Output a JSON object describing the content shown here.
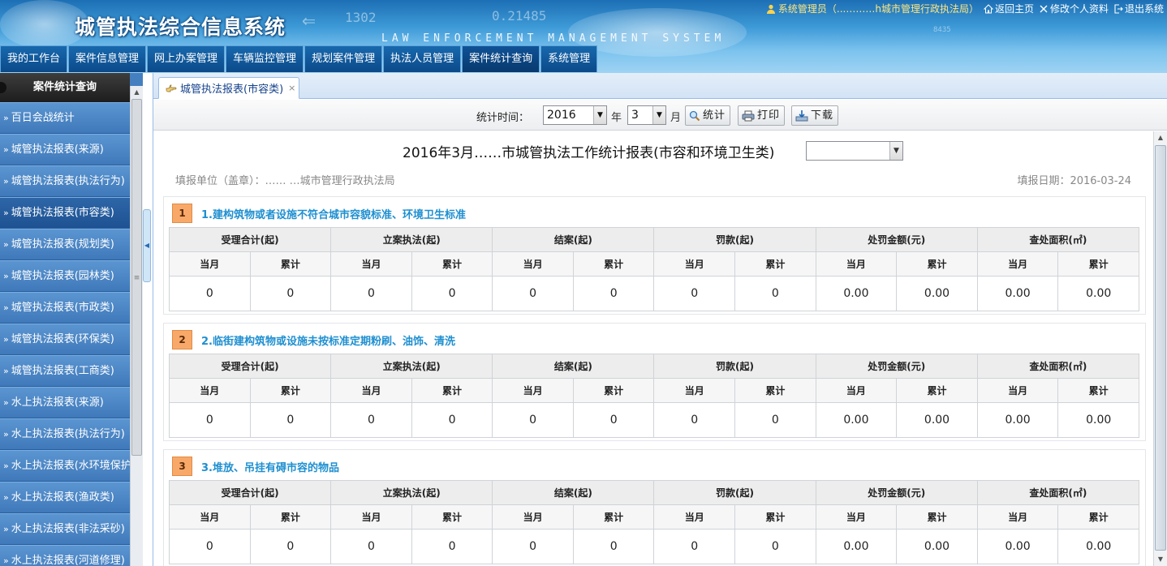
{
  "header": {
    "system_title": "城管执法综合信息系统",
    "subtitle": "LAW ENFORCEMENT MANAGEMENT SYSTEM",
    "deco_numbers": [
      "1302",
      "0.21485",
      "8435"
    ],
    "user_label": "系统管理员（...………h城市管理行政执法局）",
    "links": {
      "home": "返回主页",
      "profile": "修改个人资料",
      "logout": "退出系统"
    }
  },
  "main_nav": [
    "我的工作台",
    "案件信息管理",
    "网上办案管理",
    "车辆监控管理",
    "规划案件管理",
    "执法人员管理",
    "案件统计查询",
    "系统管理"
  ],
  "sidebar": {
    "title": "案件统计查询",
    "items": [
      "百日会战统计",
      "城管执法报表(来源)",
      "城管执法报表(执法行为)",
      "城管执法报表(市容类)",
      "城管执法报表(规划类)",
      "城管执法报表(园林类)",
      "城管执法报表(市政类)",
      "城管执法报表(环保类)",
      "城管执法报表(工商类)",
      "水上执法报表(来源)",
      "水上执法报表(执法行为)",
      "水上执法报表(水环境保护)",
      "水上执法报表(渔政类)",
      "水上执法报表(非法采砂)",
      "水上执法报表(河道修理)"
    ],
    "active_index": 3
  },
  "tab": {
    "label": "城管执法报表(市容类)"
  },
  "toolbar": {
    "label": "统计时间：",
    "year": "2016",
    "year_unit": "年",
    "month": "3",
    "month_unit": "月",
    "btn_stat": "统计",
    "btn_print": "打印",
    "btn_download": "下载"
  },
  "report": {
    "title": "2016年3月……市城管执法工作统计报表(市容和环境卫生类)",
    "fill_unit": "填报单位（盖章）：…… …城市管理行政执法局",
    "fill_date": "填报日期：2016-03-24",
    "col_groups": [
      "受理合计(起)",
      "立案执法(起)",
      "结案(起)",
      "罚款(起)",
      "处罚金额(元)",
      "查处面积(㎡)"
    ],
    "sub_cols": [
      "当月",
      "累计"
    ],
    "sections": [
      {
        "num": "1",
        "title": "1.建构筑物或者设施不符合城市容貌标准、环境卫生标准",
        "values": [
          "0",
          "0",
          "0",
          "0",
          "0",
          "0",
          "0",
          "0",
          "0.00",
          "0.00",
          "0.00",
          "0.00"
        ]
      },
      {
        "num": "2",
        "title": "2.临街建构筑物或设施未按标准定期粉刷、油饰、清洗",
        "values": [
          "0",
          "0",
          "0",
          "0",
          "0",
          "0",
          "0",
          "0",
          "0.00",
          "0.00",
          "0.00",
          "0.00"
        ]
      },
      {
        "num": "3",
        "title": "3.堆放、吊挂有碍市容的物品",
        "values": [
          "0",
          "0",
          "0",
          "0",
          "0",
          "0",
          "0",
          "0",
          "0.00",
          "0.00",
          "0.00",
          "0.00"
        ]
      }
    ]
  },
  "colors": {
    "banner": "#3f9bd8",
    "nav": "#0b4a8a",
    "sidebar": "#4480c0",
    "section_title": "#1e8fd0",
    "badge": "#f8a96a"
  }
}
